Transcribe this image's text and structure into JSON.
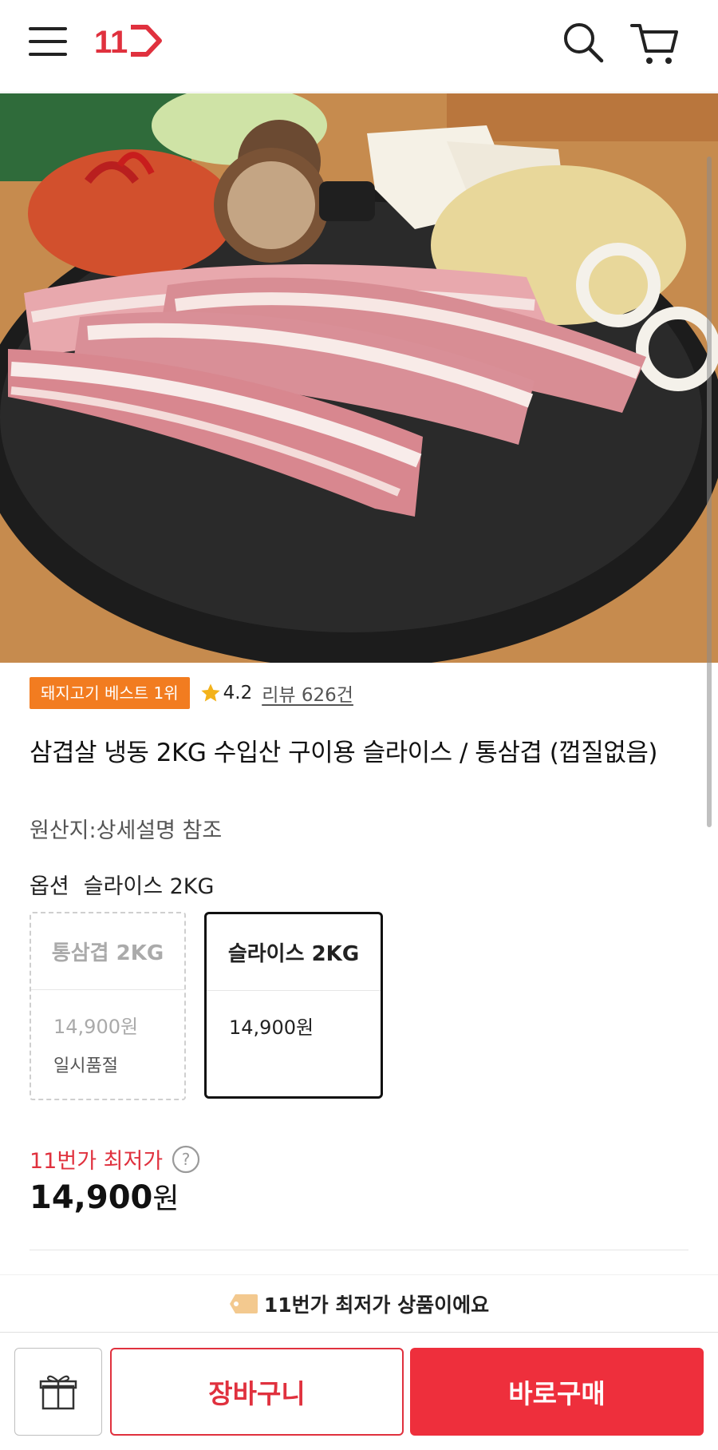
{
  "header": {
    "logo_text": "11",
    "menu_icon": "hamburger-menu-icon",
    "search_icon": "search-icon",
    "cart_icon": "cart-icon",
    "brand_color": "#e0313e"
  },
  "product": {
    "image_description_icon": "product-photo",
    "best_badge": "돼지고기 베스트 1위",
    "rating": "4.2",
    "review_link": "리뷰 626건",
    "title": "삼겹살 냉동 2KG 수입산 구이용 슬라이스 / 통삼겹 (껍질없음)",
    "origin": "원산지:상세설명 참조"
  },
  "options": {
    "label": "옵션",
    "selected_value": "슬라이스 2KG",
    "items": [
      {
        "name": "통삼겹 2KG",
        "price": "14,900원",
        "status": "일시품절",
        "selected": false
      },
      {
        "name": "슬라이스 2KG",
        "price": "14,900원",
        "status": "",
        "selected": true
      }
    ]
  },
  "pricing": {
    "lowest_label": "11번가 최저가",
    "amount": "14,900",
    "unit": "원"
  },
  "toast": {
    "text": "11번가 최저가 상품이에요"
  },
  "actions": {
    "gift_icon": "gift-icon",
    "cart_label": "장바구니",
    "buy_label": "바로구매"
  },
  "colors": {
    "accent_red": "#e0313e",
    "badge_orange": "#f27c20",
    "star_gold": "#f3b21a"
  }
}
